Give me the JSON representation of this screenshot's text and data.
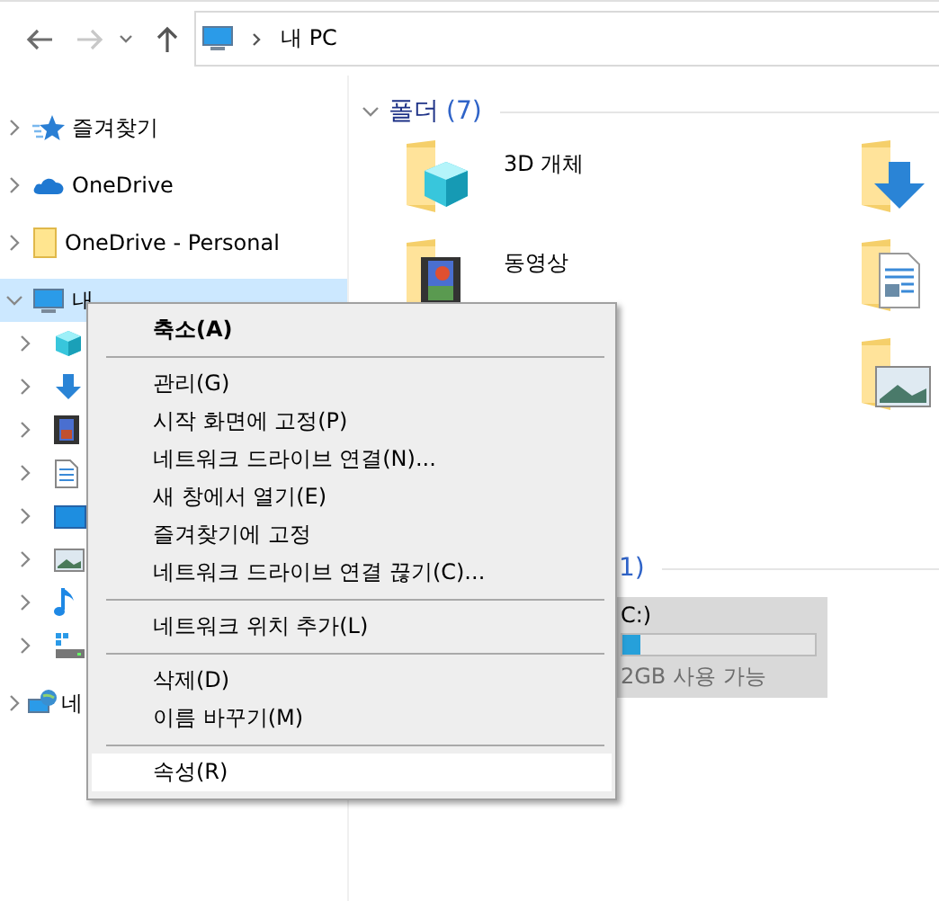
{
  "navigation": {
    "back_disabled": false,
    "forward_disabled": true
  },
  "address_bar": {
    "path": "내 PC"
  },
  "sidebar": {
    "items": [
      {
        "label": "즐겨찾기",
        "kind": "star",
        "expanded": false,
        "selected": false
      },
      {
        "label": "OneDrive",
        "kind": "cloud",
        "expanded": false,
        "selected": false
      },
      {
        "label": "OneDrive - Personal",
        "kind": "folder",
        "expanded": false,
        "selected": false
      },
      {
        "label": "내",
        "kind": "pc",
        "expanded": true,
        "selected": true,
        "children": [
          {
            "kind": "cube",
            "expanded": false
          },
          {
            "kind": "download",
            "expanded": false
          },
          {
            "kind": "video",
            "expanded": false
          },
          {
            "kind": "document",
            "expanded": false
          },
          {
            "kind": "desktop",
            "expanded": false
          },
          {
            "kind": "picture",
            "expanded": false
          },
          {
            "kind": "music",
            "expanded": false
          },
          {
            "kind": "drive",
            "expanded": false
          }
        ]
      },
      {
        "label": "네",
        "kind": "network",
        "expanded": false,
        "selected": false
      }
    ]
  },
  "folders": {
    "title": "폴더",
    "count": "(7)",
    "expanded": true,
    "columns": [
      [
        {
          "label": "3D 개체",
          "kind": "cube"
        },
        {
          "label": "동영상",
          "kind": "video"
        }
      ],
      [
        {
          "kind": "download"
        },
        {
          "kind": "document"
        },
        {
          "kind": "picture"
        }
      ]
    ]
  },
  "drives": {
    "count": "1)",
    "items": [
      {
        "label": "C:)",
        "level": 0.09,
        "free": "2GB 사용 가능"
      }
    ]
  },
  "context_menu": {
    "groups": [
      [
        {
          "label": "축소(A)",
          "default": true,
          "selected": false
        }
      ],
      [
        {
          "label": "관리(G)",
          "default": false,
          "selected": false
        },
        {
          "label": "시작 화면에 고정(P)",
          "default": false,
          "selected": false
        },
        {
          "label": "네트워크 드라이브 연결(N)...",
          "default": false,
          "selected": false
        },
        {
          "label": "새 창에서 열기(E)",
          "default": false,
          "selected": false
        },
        {
          "label": "즐겨찾기에 고정",
          "default": false,
          "selected": false
        },
        {
          "label": "네트워크 드라이브 연결 끊기(C)...",
          "default": false,
          "selected": false
        }
      ],
      [
        {
          "label": "네트워크 위치 추가(L)",
          "default": false,
          "selected": false
        }
      ],
      [
        {
          "label": "삭제(D)",
          "default": false,
          "selected": false
        },
        {
          "label": "이름 바꾸기(M)",
          "default": false,
          "selected": false
        }
      ],
      [
        {
          "label": "속성(R)",
          "default": false,
          "selected": true
        }
      ]
    ]
  }
}
